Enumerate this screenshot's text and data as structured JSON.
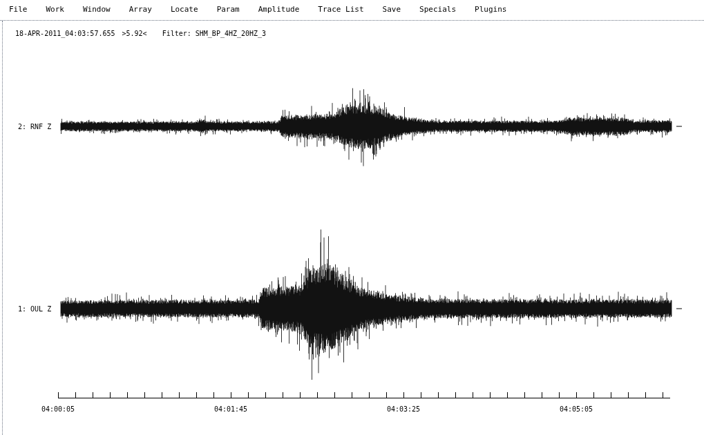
{
  "menu": [
    "File",
    "Work",
    "Window",
    "Array",
    "Locate",
    "Param",
    "Amplitude",
    "Trace List",
    "Save",
    "Specials",
    "Plugins"
  ],
  "header": {
    "timestamp": "18-APR-2011_04:03:57.655",
    "value": ">5.92<",
    "filter": "Filter: SHM_BP_4HZ_20HZ_3"
  },
  "traces": [
    {
      "label": "2: RNF Z"
    },
    {
      "label": "1: OUL Z"
    }
  ],
  "time_axis": {
    "labels": [
      "04:00:05",
      "04:01:45",
      "04:03:25",
      "04:05:05"
    ]
  }
}
